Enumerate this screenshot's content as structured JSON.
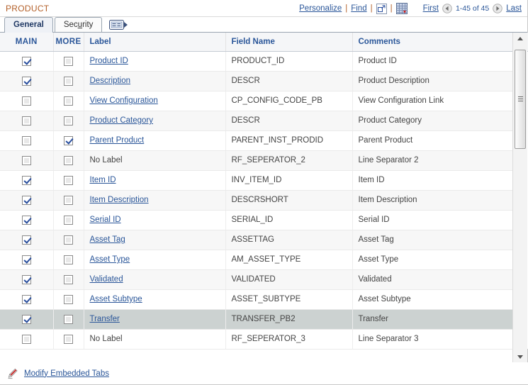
{
  "header": {
    "grid_title": "PRODUCT",
    "personalize_label": "Personalize",
    "find_label": "Find",
    "separator": "|",
    "zoom_icon": "open-in-new-window-icon",
    "download_icon": "download-to-spreadsheet-icon",
    "pager": {
      "first_label": "First",
      "prev_icon": "previous-page-arrow-icon",
      "range_label": "1-45 of 45",
      "next_icon": "next-page-arrow-icon",
      "last_label": "Last"
    }
  },
  "tabs": [
    {
      "label": "General",
      "active": true
    },
    {
      "label": "Security",
      "active": false,
      "accesskey": "u"
    }
  ],
  "tab_overflow_icon": "show-next-tab-icon",
  "columns": [
    {
      "key": "main",
      "label": "MAIN"
    },
    {
      "key": "more",
      "label": "MORE"
    },
    {
      "key": "label",
      "label": "Label"
    },
    {
      "key": "field_name",
      "label": "Field Name"
    },
    {
      "key": "comments",
      "label": "Comments"
    }
  ],
  "rows": [
    {
      "main": true,
      "more": false,
      "label": "Product ID",
      "label_is_link": true,
      "field_name": "PRODUCT_ID",
      "comments": "Product ID",
      "selected": false
    },
    {
      "main": true,
      "more": false,
      "label": "Description",
      "label_is_link": true,
      "field_name": "DESCR",
      "comments": "Product Description",
      "selected": false
    },
    {
      "main": false,
      "more": false,
      "label": "View Configuration",
      "label_is_link": true,
      "field_name": "CP_CONFIG_CODE_PB",
      "comments": "View Configuration Link",
      "selected": false
    },
    {
      "main": false,
      "more": false,
      "label": "Product Category",
      "label_is_link": true,
      "field_name": "DESCR",
      "comments": "Product Category",
      "selected": false
    },
    {
      "main": false,
      "more": true,
      "label": "Parent Product",
      "label_is_link": true,
      "field_name": "PARENT_INST_PRODID",
      "comments": "Parent Product",
      "selected": false
    },
    {
      "main": false,
      "more": false,
      "label": "No Label",
      "label_is_link": false,
      "field_name": "RF_SEPERATOR_2",
      "comments": "Line Separator 2",
      "selected": false
    },
    {
      "main": true,
      "more": false,
      "label": "Item ID",
      "label_is_link": true,
      "field_name": "INV_ITEM_ID",
      "comments": "Item ID",
      "selected": false
    },
    {
      "main": true,
      "more": false,
      "label": "Item Description",
      "label_is_link": true,
      "field_name": "DESCRSHORT",
      "comments": "Item Description",
      "selected": false
    },
    {
      "main": true,
      "more": false,
      "label": "Serial ID",
      "label_is_link": true,
      "field_name": "SERIAL_ID",
      "comments": "Serial ID",
      "selected": false
    },
    {
      "main": true,
      "more": false,
      "label": "Asset Tag",
      "label_is_link": true,
      "field_name": "ASSETTAG",
      "comments": "Asset Tag",
      "selected": false
    },
    {
      "main": true,
      "more": false,
      "label": "Asset Type",
      "label_is_link": true,
      "field_name": "AM_ASSET_TYPE",
      "comments": "Asset Type",
      "selected": false
    },
    {
      "main": true,
      "more": false,
      "label": "Validated",
      "label_is_link": true,
      "field_name": "VALIDATED",
      "comments": "Validated",
      "selected": false
    },
    {
      "main": true,
      "more": false,
      "label": "Asset Subtype",
      "label_is_link": true,
      "field_name": "ASSET_SUBTYPE",
      "comments": "Asset Subtype",
      "selected": false
    },
    {
      "main": true,
      "more": false,
      "label": "Transfer",
      "label_is_link": true,
      "field_name": "TRANSFER_PB2",
      "comments": "Transfer",
      "selected": true
    },
    {
      "main": false,
      "more": false,
      "label": "No Label",
      "label_is_link": false,
      "field_name": "RF_SEPERATOR_3",
      "comments": "Line Separator 3",
      "selected": false
    }
  ],
  "scrollbar": {
    "up_icon": "scroll-up-arrow-icon",
    "down_icon": "scroll-down-arrow-icon",
    "thumb": "scrollbar-thumb"
  },
  "footer": {
    "edit_icon": "pencil-edit-icon",
    "link_label": "Modify Embedded Tabs"
  },
  "colors": {
    "title": "#b35f28",
    "link": "#2a5699",
    "header_text": "#2a5699",
    "selected_row": "#ccd2d1",
    "stripe": "#f7f7f7"
  }
}
